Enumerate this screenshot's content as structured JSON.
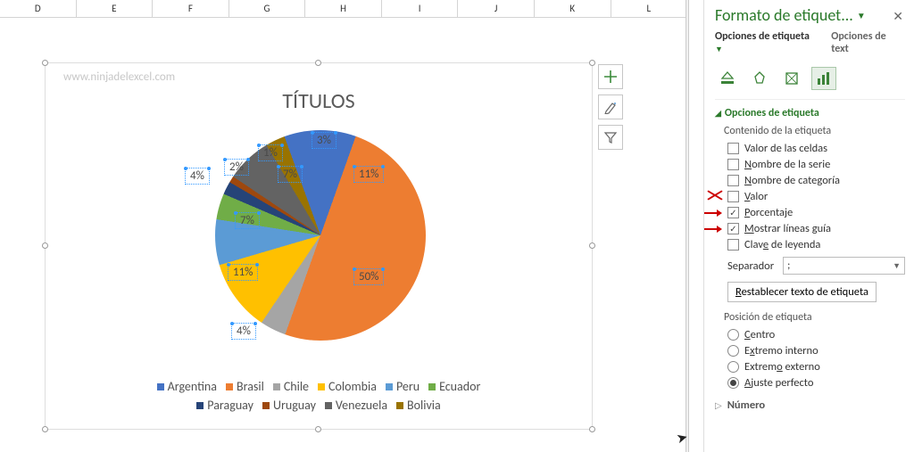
{
  "columns": [
    "D",
    "E",
    "F",
    "G",
    "H",
    "I",
    "J",
    "K",
    "L"
  ],
  "watermark": "www.ninjadelexcel.com",
  "chart": {
    "title": "TÍTULOS"
  },
  "chart_data": {
    "type": "pie",
    "title": "TÍTULOS",
    "categories": [
      "Argentina",
      "Brasil",
      "Chile",
      "Colombia",
      "Peru",
      "Ecuador",
      "Paraguay",
      "Uruguay",
      "Venezuela",
      "Bolivia"
    ],
    "values": [
      11,
      50,
      4,
      11,
      7,
      4,
      2,
      1,
      7,
      3
    ],
    "data_labels": [
      "11%",
      "50%",
      "4%",
      "11%",
      "7%",
      "4%",
      "2%",
      "1%",
      "7%",
      "3%"
    ],
    "colors": [
      "#4472C4",
      "#ED7D31",
      "#A5A5A5",
      "#FFC000",
      "#5B9BD5",
      "#70AD47",
      "#264478",
      "#9E480E",
      "#636363",
      "#997300"
    ]
  },
  "legend": [
    {
      "label": "Argentina",
      "color": "#4472C4"
    },
    {
      "label": "Brasil",
      "color": "#ED7D31"
    },
    {
      "label": "Chile",
      "color": "#A5A5A5"
    },
    {
      "label": "Colombia",
      "color": "#FFC000"
    },
    {
      "label": "Peru",
      "color": "#5B9BD5"
    },
    {
      "label": "Ecuador",
      "color": "#70AD47"
    },
    {
      "label": "Paraguay",
      "color": "#264478"
    },
    {
      "label": "Uruguay",
      "color": "#9E480E"
    },
    {
      "label": "Venezuela",
      "color": "#636363"
    },
    {
      "label": "Bolivia",
      "color": "#997300"
    }
  ],
  "pane": {
    "title": "Formato de etiquet...",
    "tabs": {
      "options": "Opciones de etiqueta",
      "text": "Opciones de text"
    },
    "section": "Opciones de etiqueta",
    "content_header": "Contenido de la etiqueta",
    "checks": {
      "cell_value": "Valor de las celdas",
      "series_name": "Nombre de la serie",
      "category_name": "Nombre de categoría",
      "value": "Valor",
      "percentage": "Porcentaje",
      "leader_lines": "Mostrar líneas guía",
      "legend_key": "Clave de leyenda"
    },
    "separator_label": "Separador",
    "separator_value": ";",
    "reset": "Restablecer texto de etiqueta",
    "position_header": "Posición de etiqueta",
    "positions": {
      "center": "Centro",
      "inside": "Extremo interno",
      "outside": "Extremo externo",
      "bestfit": "Ajuste perfecto"
    },
    "number_section": "Número"
  }
}
